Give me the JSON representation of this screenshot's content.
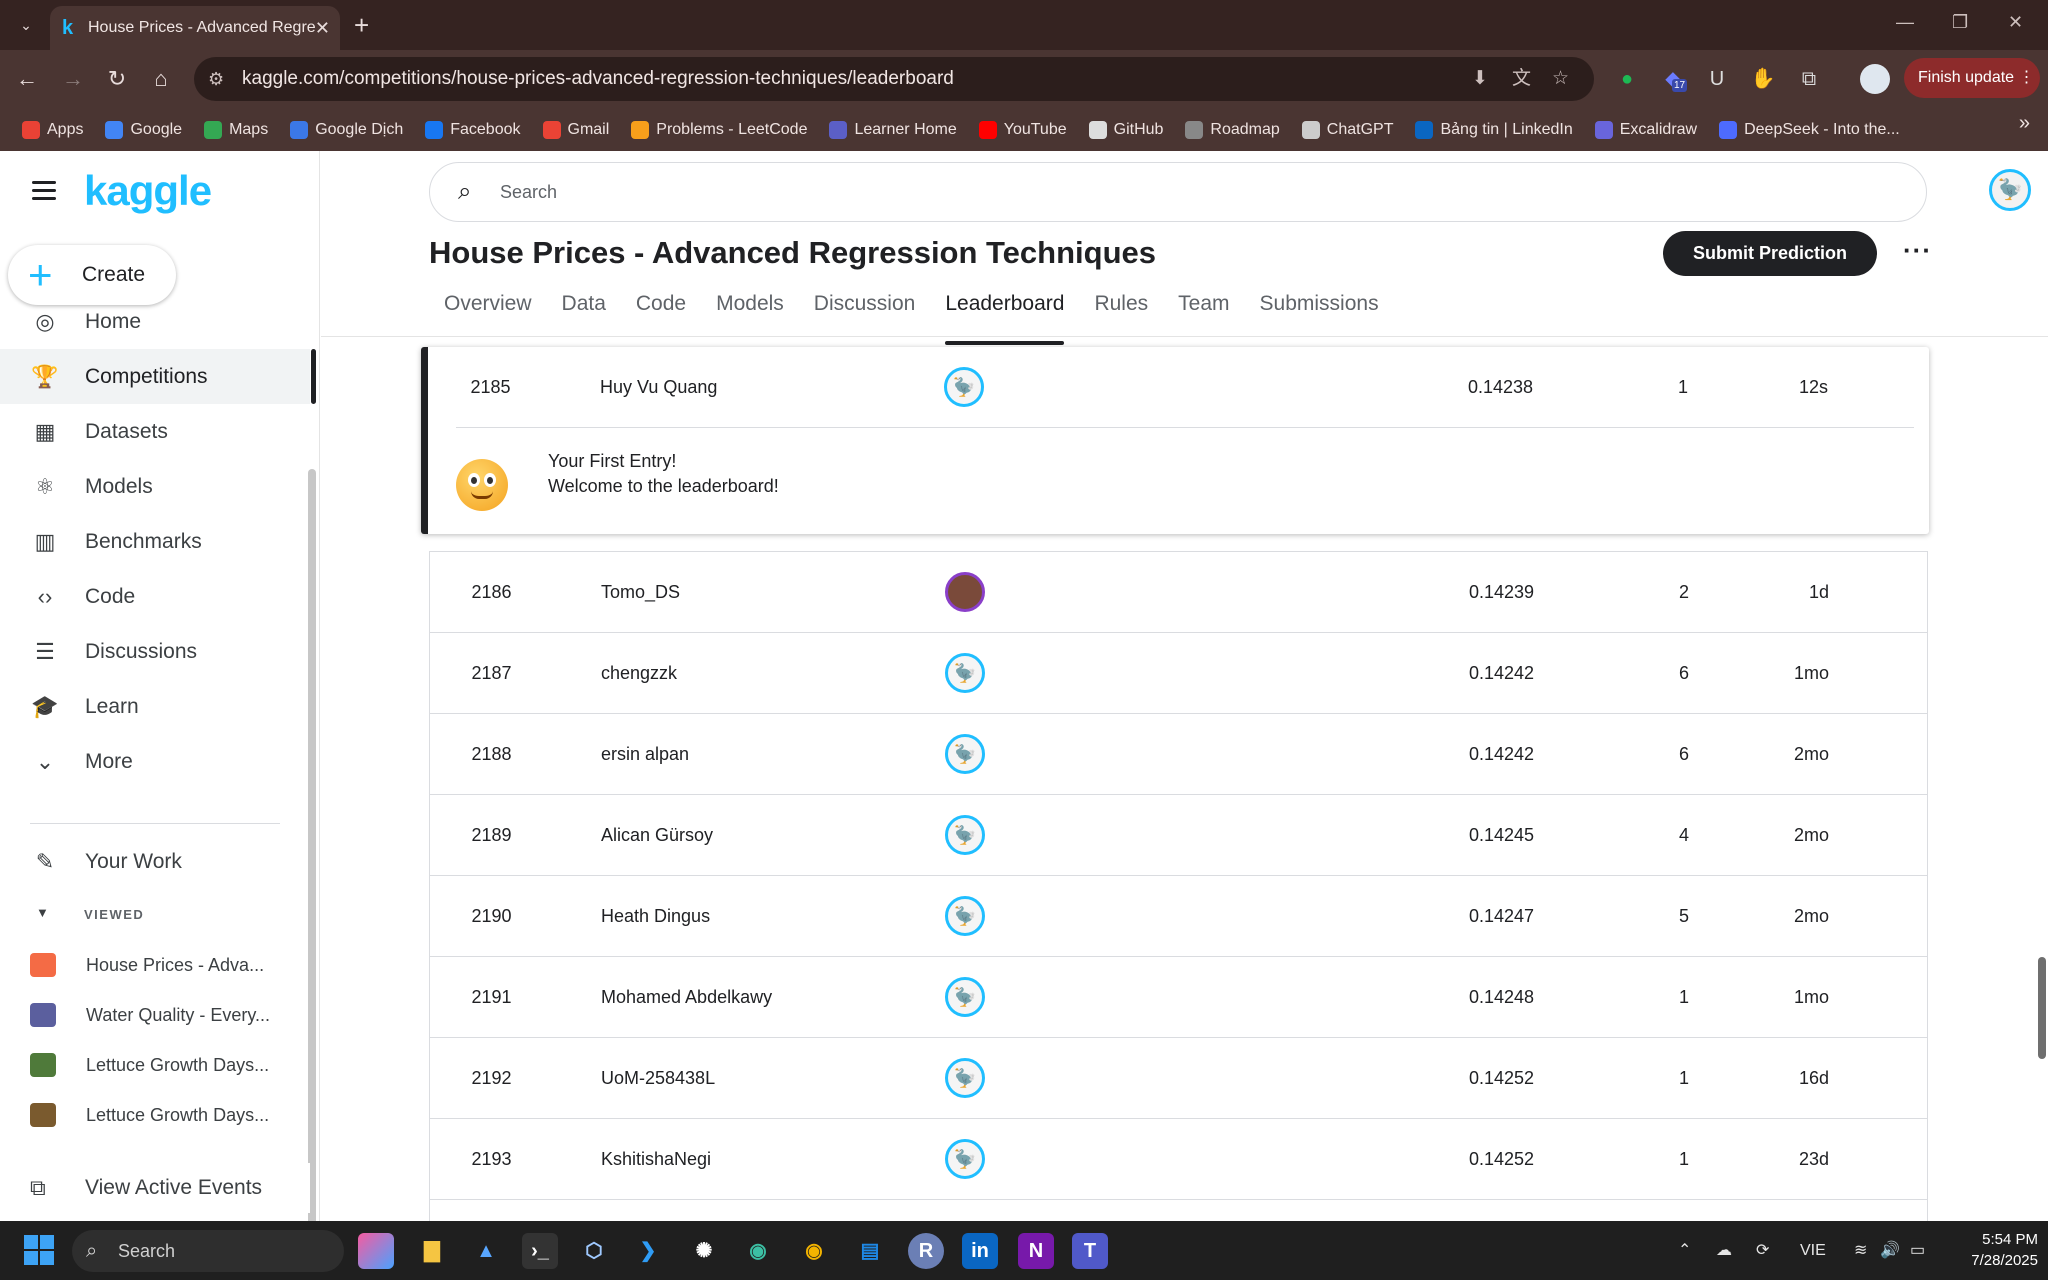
{
  "browser": {
    "tab_title": "House Prices - Advanced Regre",
    "url": "kaggle.com/competitions/house-prices-advanced-regression-techniques/leaderboard",
    "finish_update": "Finish update",
    "ext_badge": "17",
    "bookmarks": [
      "Apps",
      "Google",
      "Maps",
      "Google Dịch",
      "Facebook",
      "Gmail",
      "Problems - LeetCode",
      "Learner Home",
      "YouTube",
      "GitHub",
      "Roadmap",
      "ChatGPT",
      "Bảng tin | LinkedIn",
      "Excalidraw",
      "DeepSeek - Into the..."
    ]
  },
  "sidebar": {
    "logo": "kaggle",
    "create": "Create",
    "nav": [
      "Home",
      "Competitions",
      "Datasets",
      "Models",
      "Benchmarks",
      "Code",
      "Discussions",
      "Learn",
      "More"
    ],
    "your_work": "Your Work",
    "viewed_label": "VIEWED",
    "recent": [
      "House Prices - Adva...",
      "Water Quality - Every...",
      "Lettuce Growth Days...",
      "Lettuce Growth Days..."
    ],
    "active_events": "View Active Events"
  },
  "header": {
    "search_placeholder": "Search",
    "title": "House Prices - Advanced Regression Techniques",
    "submit": "Submit Prediction",
    "tabs": [
      "Overview",
      "Data",
      "Code",
      "Models",
      "Discussion",
      "Leaderboard",
      "Rules",
      "Team",
      "Submissions"
    ]
  },
  "leaderboard": {
    "highlight": {
      "rank": "2185",
      "name": "Huy Vu Quang",
      "score": "0.14238",
      "entries": "1",
      "last": "12s"
    },
    "welcome_line1": "Your First Entry!",
    "welcome_line2": "Welcome to the leaderboard!",
    "rows": [
      {
        "rank": "2186",
        "name": "Tomo_DS",
        "score": "0.14239",
        "entries": "2",
        "last": "1d"
      },
      {
        "rank": "2187",
        "name": "chengzzk",
        "score": "0.14242",
        "entries": "6",
        "last": "1mo"
      },
      {
        "rank": "2188",
        "name": "ersin alpan",
        "score": "0.14242",
        "entries": "6",
        "last": "2mo"
      },
      {
        "rank": "2189",
        "name": "Alican Gürsoy",
        "score": "0.14245",
        "entries": "4",
        "last": "2mo"
      },
      {
        "rank": "2190",
        "name": "Heath Dingus",
        "score": "0.14247",
        "entries": "5",
        "last": "2mo"
      },
      {
        "rank": "2191",
        "name": "Mohamed Abdelkawy",
        "score": "0.14248",
        "entries": "1",
        "last": "1mo"
      },
      {
        "rank": "2192",
        "name": "UoM-258438L",
        "score": "0.14252",
        "entries": "1",
        "last": "16d"
      },
      {
        "rank": "2193",
        "name": "KshitishaNegi",
        "score": "0.14252",
        "entries": "1",
        "last": "23d"
      }
    ]
  },
  "taskbar": {
    "search": "Search",
    "lang": "VIE",
    "time": "5:54 PM",
    "date": "7/28/2025"
  }
}
